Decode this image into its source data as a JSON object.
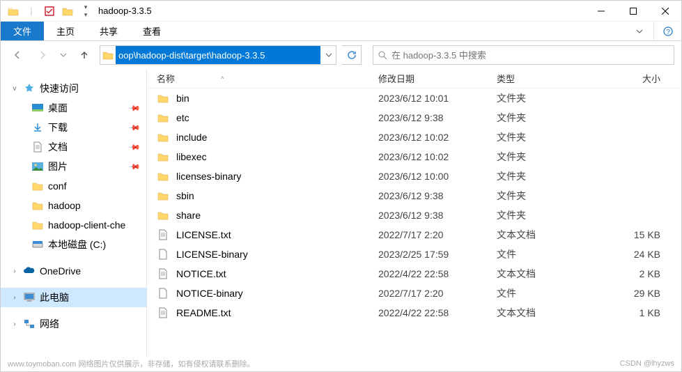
{
  "titlebar": {
    "title": "hadoop-3.3.5"
  },
  "ribbon": {
    "file": "文件",
    "tabs": [
      "主页",
      "共享",
      "查看"
    ]
  },
  "address": {
    "path": "oop\\hadoop-dist\\target\\hadoop-3.3.5"
  },
  "search": {
    "placeholder": "在 hadoop-3.3.5 中搜索"
  },
  "columns": {
    "name": "名称",
    "date": "修改日期",
    "type": "类型",
    "size": "大小"
  },
  "sidebar": {
    "quick": "快速访问",
    "desktop": "桌面",
    "downloads": "下载",
    "documents": "文档",
    "pictures": "图片",
    "conf": "conf",
    "hadoop": "hadoop",
    "hadoop_client": "hadoop-client-che",
    "localdisk": "本地磁盘 (C:)",
    "onedrive": "OneDrive",
    "thispc": "此电脑",
    "network": "网络"
  },
  "files": [
    {
      "name": "bin",
      "date": "2023/6/12 10:01",
      "type": "文件夹",
      "size": "",
      "kind": "folder"
    },
    {
      "name": "etc",
      "date": "2023/6/12 9:38",
      "type": "文件夹",
      "size": "",
      "kind": "folder"
    },
    {
      "name": "include",
      "date": "2023/6/12 10:02",
      "type": "文件夹",
      "size": "",
      "kind": "folder"
    },
    {
      "name": "libexec",
      "date": "2023/6/12 10:02",
      "type": "文件夹",
      "size": "",
      "kind": "folder"
    },
    {
      "name": "licenses-binary",
      "date": "2023/6/12 10:00",
      "type": "文件夹",
      "size": "",
      "kind": "folder"
    },
    {
      "name": "sbin",
      "date": "2023/6/12 9:38",
      "type": "文件夹",
      "size": "",
      "kind": "folder"
    },
    {
      "name": "share",
      "date": "2023/6/12 9:38",
      "type": "文件夹",
      "size": "",
      "kind": "folder"
    },
    {
      "name": "LICENSE.txt",
      "date": "2022/7/17 2:20",
      "type": "文本文档",
      "size": "15 KB",
      "kind": "text"
    },
    {
      "name": "LICENSE-binary",
      "date": "2023/2/25 17:59",
      "type": "文件",
      "size": "24 KB",
      "kind": "file"
    },
    {
      "name": "NOTICE.txt",
      "date": "2022/4/22 22:58",
      "type": "文本文档",
      "size": "2 KB",
      "kind": "text"
    },
    {
      "name": "NOTICE-binary",
      "date": "2022/7/17 2:20",
      "type": "文件",
      "size": "29 KB",
      "kind": "file"
    },
    {
      "name": "README.txt",
      "date": "2022/4/22 22:58",
      "type": "文本文档",
      "size": "1 KB",
      "kind": "text"
    }
  ],
  "footer": {
    "left": "www.toymoban.com  网络图片仅供展示，非存储，如有侵权请联系删除。",
    "right": "CSDN @lhyzws"
  }
}
